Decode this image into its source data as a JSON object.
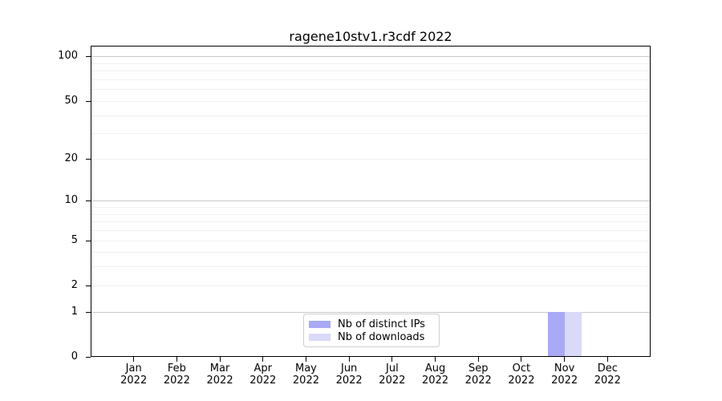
{
  "title": "ragene10stv1.r3cdf 2022",
  "chart_data": {
    "type": "bar",
    "title": "ragene10stv1.r3cdf 2022",
    "year": "2022",
    "categories": [
      "Jan 2022",
      "Feb 2022",
      "Mar 2022",
      "Apr 2022",
      "May 2022",
      "Jun 2022",
      "Jul 2022",
      "Aug 2022",
      "Sep 2022",
      "Oct 2022",
      "Nov 2022",
      "Dec 2022"
    ],
    "series": [
      {
        "name": "Nb of distinct IPs",
        "color": "#a9a9f6",
        "values": [
          0,
          0,
          0,
          0,
          0,
          0,
          0,
          0,
          0,
          0,
          1,
          0
        ]
      },
      {
        "name": "Nb of downloads",
        "color": "#d9d9f8",
        "values": [
          0,
          0,
          0,
          0,
          0,
          0,
          0,
          0,
          0,
          0,
          1,
          0
        ]
      }
    ],
    "xlabel": "",
    "ylabel": "",
    "yscale": "log1p",
    "ylim": [
      0,
      118
    ],
    "y_tick_values": [
      0,
      1,
      2,
      5,
      10,
      20,
      50,
      100
    ],
    "y_tick_labels": [
      "0",
      "1",
      "2",
      "5",
      "10",
      "20",
      "50",
      "100"
    ],
    "y_major_gridlines": [
      1,
      10,
      100
    ],
    "y_minor_gridlines": [
      2,
      3,
      4,
      5,
      6,
      7,
      8,
      9,
      20,
      30,
      40,
      50,
      60,
      70,
      80,
      90
    ],
    "grid": true,
    "legend_position": "lower center",
    "colors": {
      "major_grid": "#c9c9c9",
      "minor_grid": "#f0f0f0",
      "spine": "#000000",
      "background": "#ffffff"
    }
  }
}
